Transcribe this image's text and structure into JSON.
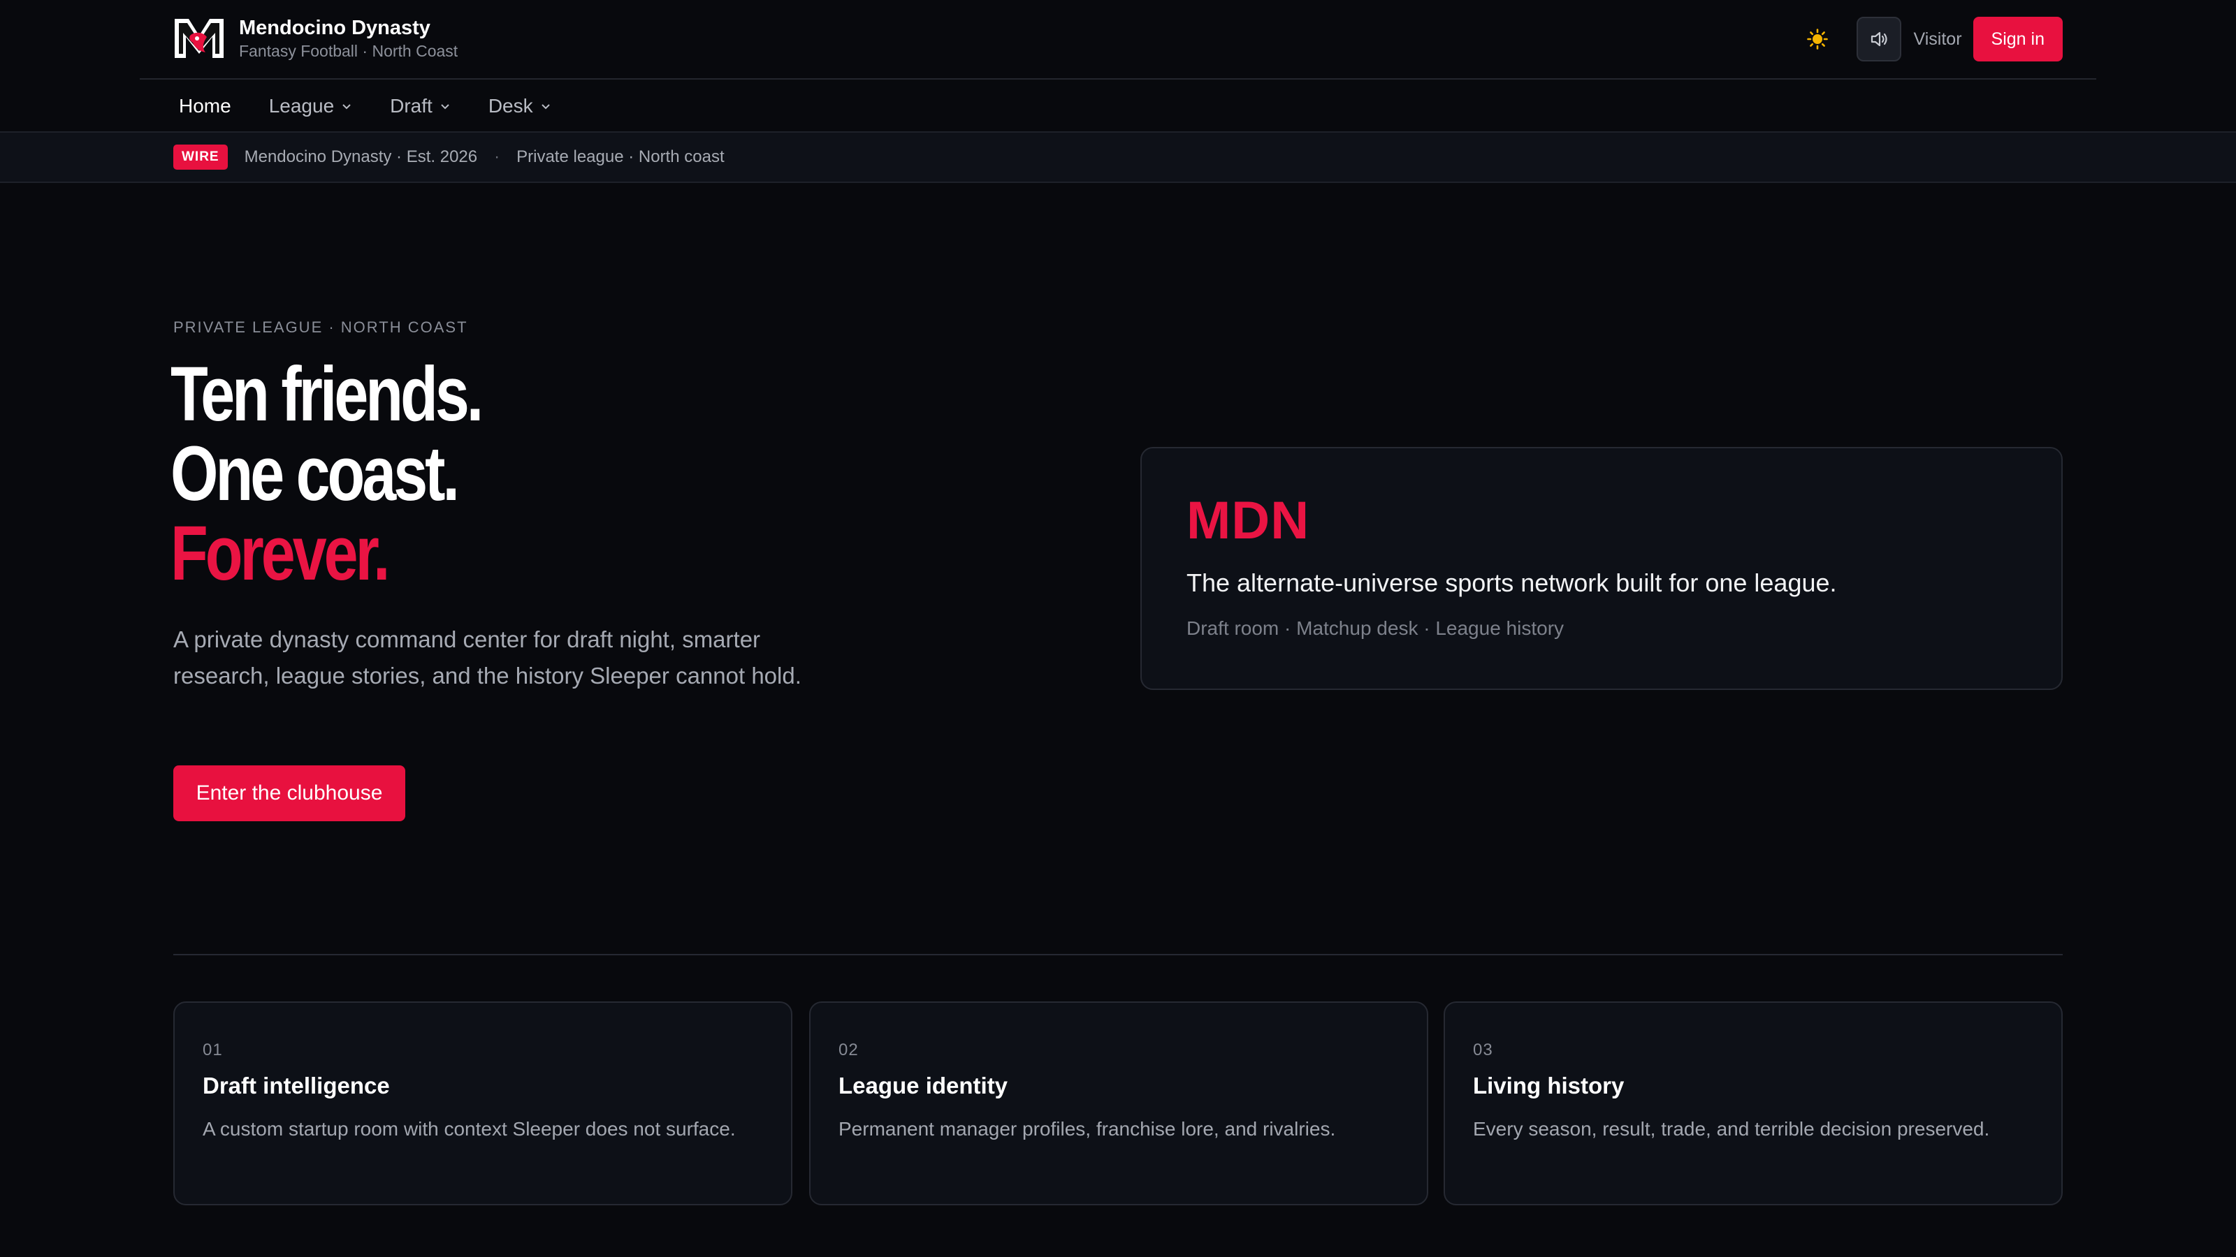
{
  "header": {
    "brand_name": "Mendocino Dynasty",
    "brand_sub": "Fantasy Football · North Coast",
    "logo_icon": "mendocino-m-logo-icon",
    "visitor_label": "Visitor",
    "signin_label": "Sign in",
    "theme_icon": "sun-icon",
    "sound_icon": "speaker-icon"
  },
  "nav": {
    "items": [
      {
        "label": "Home",
        "active": true
      },
      {
        "label": "League",
        "dropdown": true
      },
      {
        "label": "Draft",
        "dropdown": true
      },
      {
        "label": "Desk",
        "dropdown": true
      }
    ]
  },
  "wire": {
    "badge": "WIRE",
    "item1": "Mendocino Dynasty · Est. 2026",
    "separator": "·",
    "item2": "Private league · North coast"
  },
  "hero": {
    "eyebrow": "PRIVATE LEAGUE · NORTH COAST",
    "line1": "Ten friends.",
    "line2": "One coast.",
    "line3": "Forever.",
    "lede": "A private dynasty command center for draft night, smarter research, league stories, and the history Sleeper cannot hold.",
    "cta": "Enter the clubhouse"
  },
  "mdn_card": {
    "title": "MDN",
    "tagline": "The alternate-universe sports network built for one league.",
    "meta": "Draft room · Matchup desk · League history"
  },
  "features": [
    {
      "num": "01",
      "title": "Draft intelligence",
      "desc": "A custom startup room with context Sleeper does not surface."
    },
    {
      "num": "02",
      "title": "League identity",
      "desc": "Permanent manager profiles, franchise lore, and rivalries."
    },
    {
      "num": "03",
      "title": "Living history",
      "desc": "Every season, result, trade, and terrible decision preserved."
    }
  ],
  "colors": {
    "background": "#08090d",
    "accent": "#e8113f",
    "card": "#0d1017",
    "border": "#262932"
  }
}
